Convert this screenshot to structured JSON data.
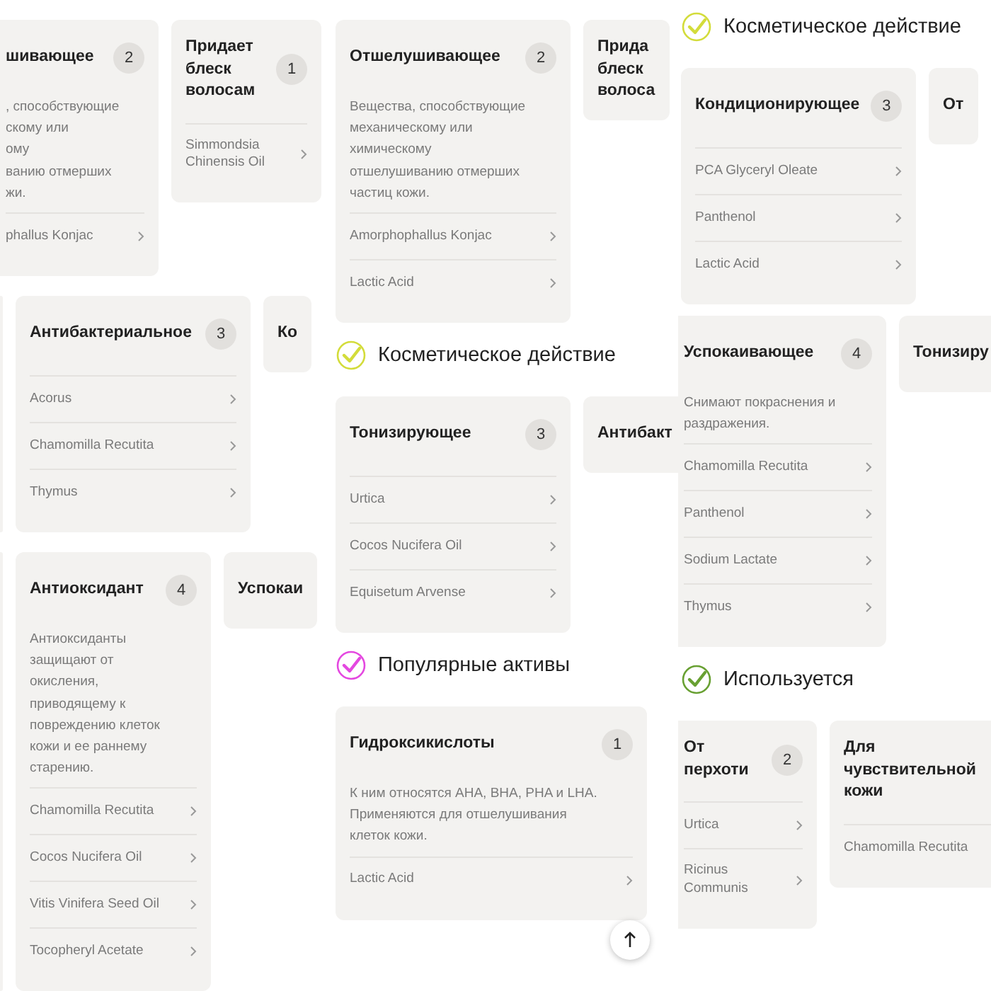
{
  "columns": [
    {
      "sections": [
        {
          "cards": [
            {
              "kind": "card",
              "cut_left": true,
              "title": "шивающее",
              "count": "2",
              "description_lines": [
                ", способствующие",
                "скому или",
                "ому",
                "ванию отмерших",
                "жи."
              ],
              "ingredients": [
                "phallus Konjac"
              ]
            },
            {
              "kind": "narrow",
              "cut_left": false,
              "title": "Придает блеск волосам",
              "count": "1",
              "ingredients": [
                "Simmondsia Chinensis Oil"
              ]
            }
          ]
        },
        {
          "cards": [
            {
              "kind": "sliver"
            },
            {
              "kind": "card",
              "title": "Антибактериальное",
              "count": "3",
              "ingredients": [
                "Acorus",
                "Chamomilla Recutita",
                "Thymus"
              ]
            },
            {
              "kind": "peek",
              "title": "Ко"
            }
          ]
        },
        {
          "cards": [
            {
              "kind": "sliver"
            },
            {
              "kind": "card",
              "title": "Антиоксидант",
              "count": "4",
              "description_lines": [
                "Антиоксиданты",
                "защищают от",
                "окисления,",
                "приводящему к",
                "повреждению клеток",
                "кожи и ее раннему",
                "старению."
              ],
              "ingredients": [
                "Chamomilla Recutita",
                "Cocos Nucifera Oil",
                "Vitis Vinifera Seed Oil",
                "Tocopheryl Acetate"
              ]
            },
            {
              "kind": "peek",
              "title": "Успокаи"
            }
          ]
        }
      ]
    },
    {
      "sections": [
        {
          "cards": [
            {
              "kind": "card",
              "title": "Отшелушивающее",
              "count": "2",
              "description_lines": [
                "Вещества, способствующие",
                "механическому или",
                "химическому",
                "отшелушиванию отмерших",
                "частиц кожи."
              ],
              "ingredients": [
                "Amorphophallus Konjac",
                "Lactic Acid"
              ]
            },
            {
              "kind": "peek",
              "narrow": true,
              "title": "Прида блеск волоса"
            }
          ]
        },
        {
          "heading": {
            "text": "Косметическое действие",
            "color": "#d3dc3a"
          },
          "cards": [
            {
              "kind": "card",
              "title": "Тонизирующее",
              "count": "3",
              "ingredients": [
                "Urtica",
                "Cocos Nucifera Oil",
                "Equisetum Arvense"
              ]
            },
            {
              "kind": "peek",
              "title": "Антибакт"
            }
          ]
        },
        {
          "heading": {
            "text": "Популярные активы",
            "color": "#e448e0"
          },
          "cards": [
            {
              "kind": "wide",
              "title": "Гидроксикислоты",
              "count": "1",
              "description_lines": [
                "К ним относятся AHA, BHA, PHA и LHA.",
                "Применяются для отшелушивания",
                "клеток кожи."
              ],
              "ingredients": [
                "Lactic Acid"
              ]
            }
          ]
        }
      ],
      "scroll_top": true
    },
    {
      "sections": [
        {
          "heading": {
            "text": "Косметическое действие",
            "color": "#d3dc3a"
          },
          "cards": [
            {
              "kind": "card",
              "title": "Кондиционирующее",
              "count": "3",
              "ingredients": [
                "PCA Glyceryl Oleate",
                "Panthenol",
                "Lactic Acid"
              ]
            },
            {
              "kind": "peek",
              "title": "От"
            }
          ]
        },
        {
          "cards": [
            {
              "kind": "card",
              "cut_left": true,
              "title": "Успокаивающее",
              "count": "4",
              "description_lines": [
                "Снимают покраснения и",
                "раздражения."
              ],
              "ingredients": [
                "Chamomilla Recutita",
                "Panthenol",
                "Sodium Lactate",
                "Thymus"
              ]
            },
            {
              "kind": "peek",
              "title": "Тонизиру"
            }
          ]
        },
        {
          "heading": {
            "text": "Используется",
            "color": "#68a032"
          },
          "cards": [
            {
              "kind": "narrow",
              "cut_left": true,
              "cut_right": false,
              "title": "От перхоти",
              "count": "2",
              "ingredients": [
                "Urtica",
                "Ricinus Communis"
              ]
            },
            {
              "kind": "narrow",
              "cut_left": false,
              "cut_right": true,
              "title": "Для чувствительной кожи",
              "ingredients": [
                "Chamomilla Recutita"
              ]
            }
          ]
        }
      ]
    }
  ]
}
